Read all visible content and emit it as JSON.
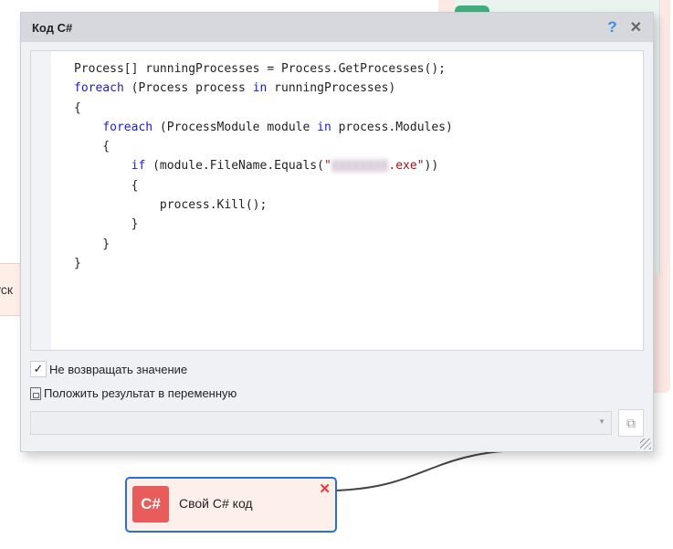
{
  "dialog": {
    "title": "Код C#",
    "help_label": "?",
    "close_label": "✕"
  },
  "code": [
    [
      {
        "t": "Process[] runningProcesses = Process.GetProcesses();"
      }
    ],
    [
      {
        "t": "foreach",
        "k": "kw"
      },
      {
        "t": " (Process process "
      },
      {
        "t": "in",
        "k": "kw"
      },
      {
        "t": " runningProcesses)"
      }
    ],
    [
      {
        "t": "{"
      }
    ],
    [
      {
        "t": "    "
      },
      {
        "t": "foreach",
        "k": "kw"
      },
      {
        "t": " (ProcessModule module "
      },
      {
        "t": "in",
        "k": "kw"
      },
      {
        "t": " process.Modules)"
      }
    ],
    [
      {
        "t": "    {"
      }
    ],
    [
      {
        "t": "        "
      },
      {
        "t": "if",
        "k": "kw"
      },
      {
        "t": " (module.FileName.Equals("
      },
      {
        "t": "\"",
        "k": "str"
      },
      {
        "t": "xxxxxxxx",
        "k": "blur"
      },
      {
        "t": ".exe\"",
        "k": "str"
      },
      {
        "t": "))"
      }
    ],
    [
      {
        "t": "        {"
      }
    ],
    [
      {
        "t": "            process.Kill();"
      }
    ],
    [
      {
        "t": "        }"
      }
    ],
    [
      {
        "t": "    }"
      }
    ],
    [
      {
        "t": "}"
      }
    ]
  ],
  "options": {
    "no_return_label": "Не возвращать значение",
    "no_return_checked": true,
    "check_mark": "✓",
    "save_result_label": "Положить результат в переменную",
    "variable_value": ""
  },
  "node": {
    "icon_text": "C#",
    "label": "Свой C# код",
    "delete_label": "✕"
  },
  "left_node": {
    "label_fragment": "уск"
  }
}
